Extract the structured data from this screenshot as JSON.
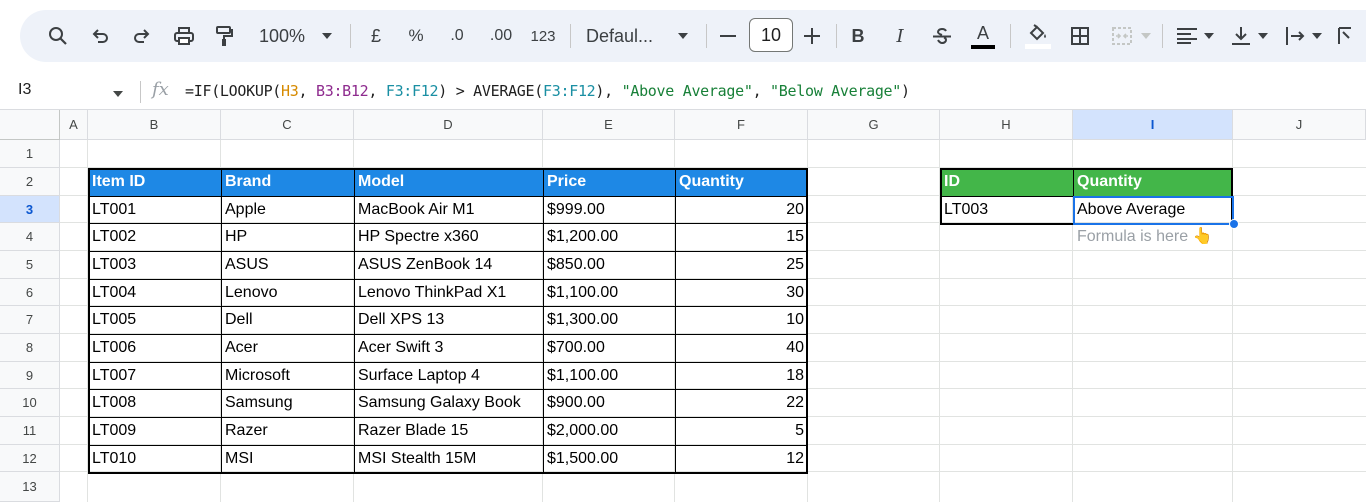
{
  "toolbar": {
    "zoom": "100%",
    "currency": "£",
    "percent": "%",
    "decrease_decimal": ".0",
    "increase_decimal": ".00",
    "number_format": "123",
    "font_family": "Defaul...",
    "font_size": "10",
    "bold": "B",
    "italic": "I",
    "text_color_letter": "A"
  },
  "formula_bar": {
    "cell_ref": "I3",
    "fx": "fx",
    "formula_parts": {
      "p1": "=IF(LOOKUP(",
      "p2": "H3",
      "p3": ", ",
      "p4": "B3:B12",
      "p5": ", ",
      "p6": "F3:F12",
      "p7": ") > AVERAGE(",
      "p8": "F3:F12",
      "p9": "), ",
      "p10": "\"Above Average\"",
      "p11": ", ",
      "p12": "\"Below Average\"",
      "p13": ")"
    }
  },
  "columns": [
    "A",
    "B",
    "C",
    "D",
    "E",
    "F",
    "G",
    "H",
    "I",
    "J"
  ],
  "rows": [
    "1",
    "2",
    "3",
    "4",
    "5",
    "6",
    "7",
    "8",
    "9",
    "10",
    "11",
    "12",
    "13"
  ],
  "main_table": {
    "headers": [
      "Item ID",
      "Brand",
      "Model",
      "Price",
      "Quantity"
    ],
    "rows": [
      [
        "LT001",
        "Apple",
        "MacBook Air M1",
        "$999.00",
        "20"
      ],
      [
        "LT002",
        "HP",
        "HP Spectre x360",
        "$1,200.00",
        "15"
      ],
      [
        "LT003",
        "ASUS",
        "ASUS ZenBook 14",
        "$850.00",
        "25"
      ],
      [
        "LT004",
        "Lenovo",
        "Lenovo ThinkPad X1",
        "$1,100.00",
        "30"
      ],
      [
        "LT005",
        "Dell",
        "Dell XPS 13",
        "$1,300.00",
        "10"
      ],
      [
        "LT006",
        "Acer",
        "Acer Swift 3",
        "$700.00",
        "40"
      ],
      [
        "LT007",
        "Microsoft",
        "Surface Laptop 4",
        "$1,100.00",
        "18"
      ],
      [
        "LT008",
        "Samsung",
        "Samsung Galaxy Book",
        "$900.00",
        "22"
      ],
      [
        "LT009",
        "Razer",
        "Razer Blade 15",
        "$2,000.00",
        "5"
      ],
      [
        "LT010",
        "MSI",
        "MSI Stealth 15M",
        "$1,500.00",
        "12"
      ]
    ]
  },
  "lookup_table": {
    "headers": [
      "ID",
      "Quantity"
    ],
    "id_value": "LT003",
    "result_value": "Above Average",
    "note": "Formula is here 👆"
  },
  "colors": {
    "header_blue": "#1e88e5",
    "header_green": "#43b649",
    "selection_blue": "#1a73e8"
  }
}
